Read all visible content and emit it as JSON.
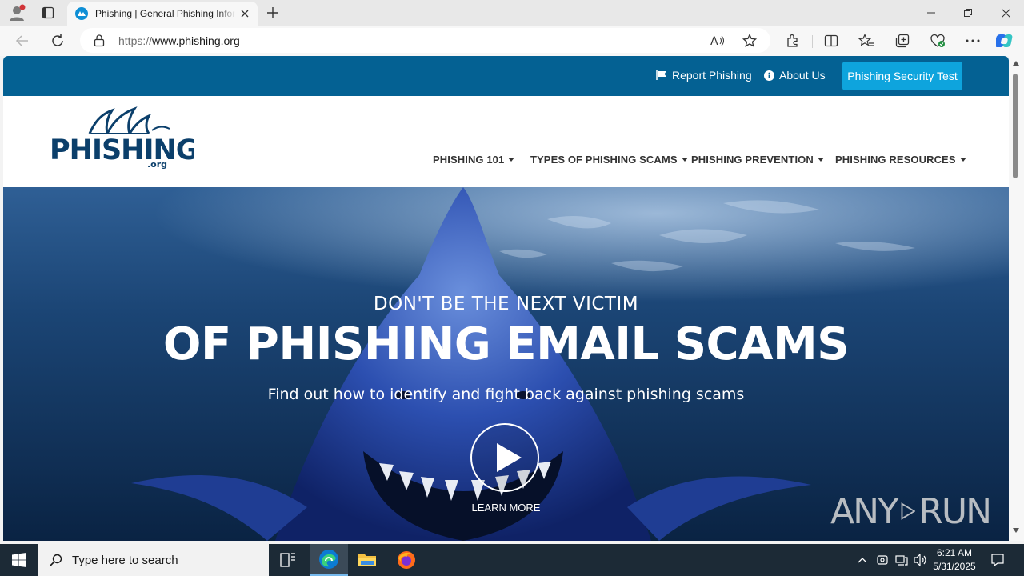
{
  "browser": {
    "tab_title": "Phishing | General Phishing Information",
    "url_scheme": "https://",
    "url_host": "www.phishing.org",
    "close_tab_icon": "close-icon",
    "new_tab_icon": "plus-icon"
  },
  "site": {
    "topbar": {
      "report_phishing": "Report Phishing",
      "about_us": "About Us",
      "security_test": "Phishing Security Test"
    },
    "logo": {
      "name": "PHISHING",
      "tld": ".org"
    },
    "nav": [
      {
        "label": "PHISHING 101"
      },
      {
        "label": "TYPES OF PHISHING SCAMS"
      },
      {
        "label": "PHISHING PREVENTION"
      },
      {
        "label": "PHISHING RESOURCES"
      }
    ],
    "hero": {
      "kicker": "DON'T BE THE NEXT VICTIM",
      "headline": "OF PHISHING EMAIL SCAMS",
      "subline": "Find out how to identify and fight back against phishing scams",
      "cta": "LEARN MORE"
    },
    "colors": {
      "topbar": "#046193",
      "button": "#0ea4dd",
      "logo": "#0b3f6b"
    }
  },
  "watermark": {
    "text_left": "ANY",
    "text_right": "RUN"
  },
  "taskbar": {
    "search_placeholder": "Type here to search",
    "time": "6:21 AM",
    "date": "5/31/2025"
  }
}
